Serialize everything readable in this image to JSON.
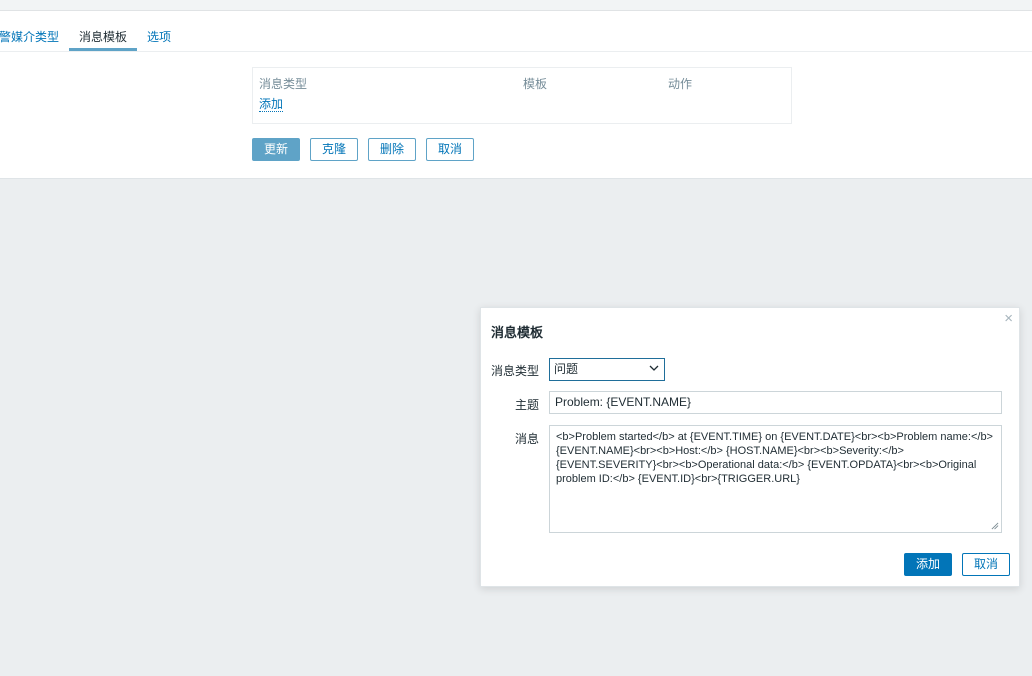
{
  "tabs": [
    {
      "label": "警媒介类型"
    },
    {
      "label": "消息模板"
    },
    {
      "label": "选项"
    }
  ],
  "templates_table": {
    "headers": [
      "消息类型",
      "模板",
      "动作"
    ],
    "add_link": "添加"
  },
  "form_buttons": {
    "update": "更新",
    "clone": "克隆",
    "delete": "删除",
    "cancel": "取消"
  },
  "dialog": {
    "title": "消息模板",
    "message_type_label": "消息类型",
    "message_type_value": "问题",
    "subject_label": "主题",
    "subject_value": "Problem: {EVENT.NAME}",
    "message_label": "消息",
    "message_value": "<b>Problem started</b> at {EVENT.TIME} on {EVENT.DATE}<br><b>Problem name:</b> {EVENT.NAME}<br><b>Host:</b> {HOST.NAME}<br><b>Severity:</b> {EVENT.SEVERITY}<br><b>Operational data:</b> {EVENT.OPDATA}<br><b>Original problem ID:</b> {EVENT.ID}<br>{TRIGGER.URL}",
    "add_button": "添加",
    "cancel_button": "取消",
    "close_symbol": "×"
  }
}
